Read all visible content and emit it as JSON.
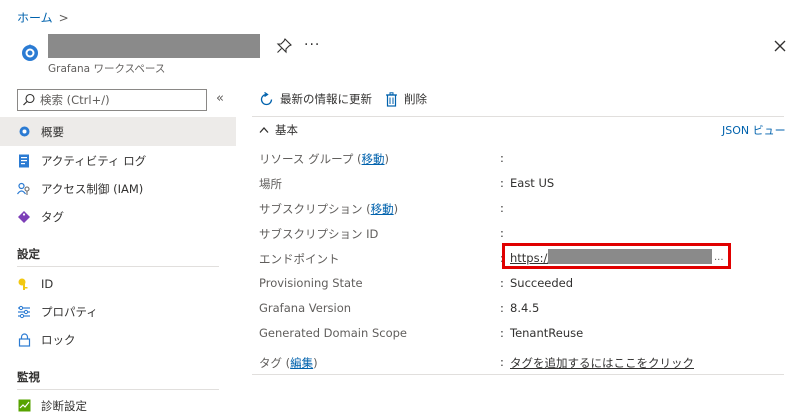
{
  "breadcrumb": {
    "home": "ホーム",
    "separator": ">"
  },
  "header": {
    "subtitle": "Grafana ワークスペース",
    "more": "···"
  },
  "sidebar": {
    "search_placeholder": "検索 (Ctrl+/)",
    "collapse": "«",
    "items": [
      {
        "label": "概要",
        "icon": "gear-icon"
      },
      {
        "label": "アクティビティ ログ",
        "icon": "activity-log-icon"
      },
      {
        "label": "アクセス制御 (IAM)",
        "icon": "iam-icon"
      },
      {
        "label": "タグ",
        "icon": "tag-icon"
      }
    ],
    "settings_section": "設定",
    "settings_items": [
      {
        "label": "ID",
        "icon": "identity-icon"
      },
      {
        "label": "プロパティ",
        "icon": "properties-icon"
      },
      {
        "label": "ロック",
        "icon": "lock-icon"
      }
    ],
    "monitoring_section": "監視",
    "monitoring_items": [
      {
        "label": "診断設定",
        "icon": "diagnostics-icon"
      }
    ]
  },
  "toolbar": {
    "refresh_label": "最新の情報に更新",
    "delete_label": "削除"
  },
  "essentials": {
    "heading": "基本",
    "json_view": "JSON ビュー",
    "colon": ":",
    "props": {
      "resource_group_label": "リソース グループ (",
      "move_link": "移動",
      "close_paren": ")",
      "location_label": "場所",
      "location_value": "East US",
      "subscription_label": "サブスクリプション (",
      "subscription_id_label": "サブスクリプション ID",
      "endpoint_label": "エンドポイント",
      "endpoint_value": "https://",
      "endpoint_ellipsis": "...",
      "provisioning_label": "Provisioning State",
      "provisioning_value": "Succeeded",
      "grafana_version_label": "Grafana Version",
      "grafana_version_value": "8.4.5",
      "domain_scope_label": "Generated Domain Scope",
      "domain_scope_value": "TenantReuse",
      "tags_label": "タグ (",
      "edit_link": "編集",
      "tags_value": "タグを追加するにはここをクリック"
    }
  },
  "colors": {
    "link": "#0062ad",
    "highlight_box": "#e00000",
    "redaction": "#8a8a8a",
    "active_nav": "#edebe9"
  }
}
